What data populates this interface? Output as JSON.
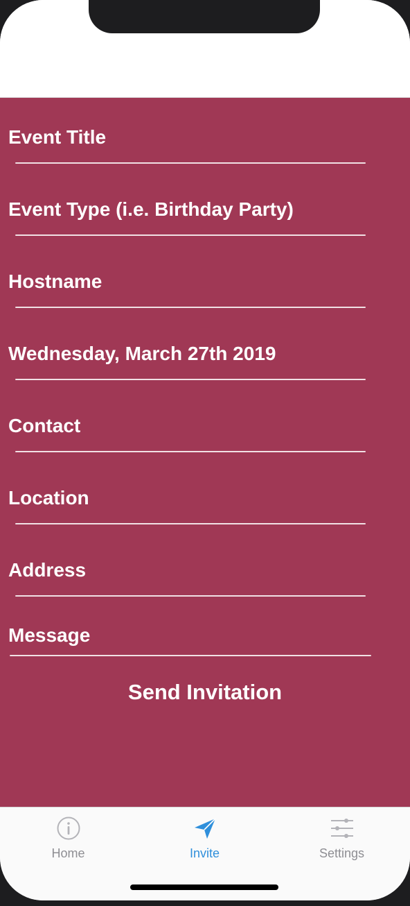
{
  "form": {
    "fields": [
      {
        "id": "event-title",
        "value": "Event Title"
      },
      {
        "id": "event-type",
        "value": "Event Type (i.e. Birthday Party)"
      },
      {
        "id": "hostname",
        "value": "Hostname"
      },
      {
        "id": "date",
        "value": "Wednesday, March 27th 2019"
      },
      {
        "id": "contact",
        "value": "Contact"
      },
      {
        "id": "location",
        "value": "Location"
      },
      {
        "id": "address",
        "value": "Address"
      },
      {
        "id": "message",
        "value": "Message"
      }
    ],
    "send_label": "Send Invitation",
    "background_color": "#a03855"
  },
  "tab_bar": {
    "tabs": [
      {
        "label": "Home",
        "icon": "info-icon",
        "active": false
      },
      {
        "label": "Invite",
        "icon": "paper-plane-icon",
        "active": true
      },
      {
        "label": "Settings",
        "icon": "sliders-icon",
        "active": false
      }
    ],
    "active_color": "#2f8fdb",
    "inactive_color": "#8e8e93"
  }
}
